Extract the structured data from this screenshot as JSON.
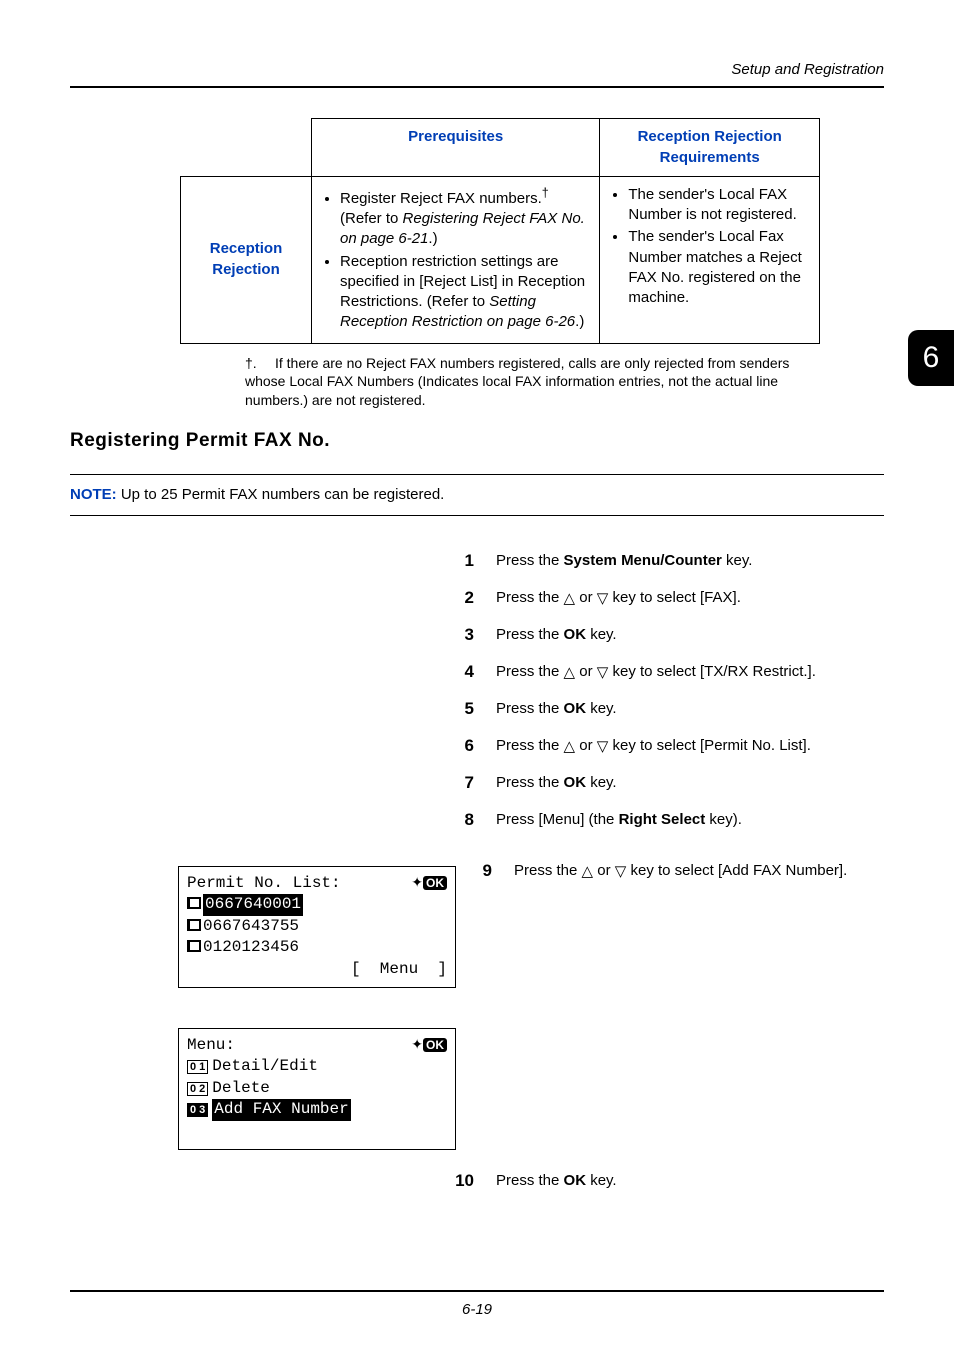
{
  "header": {
    "section": "Setup and Registration"
  },
  "chapterTab": "6",
  "table": {
    "headers": {
      "prereq": "Prerequisites",
      "req": "Reception Rejection Requirements"
    },
    "rowLabel": "Reception Rejection",
    "prereq": {
      "b1a": "Register Reject FAX numbers.",
      "b1b": "  (Refer to ",
      "b1c": "Registering Reject FAX No. on page 6-21",
      "b1d": ".)",
      "b2a": "Reception restriction settings are specified in [Reject List] in Reception Restrictions. (Refer to ",
      "b2b": "Setting Reception Restriction on page 6-26",
      "b2c": ".)"
    },
    "req": {
      "b1": "The sender's Local FAX Number is not registered.",
      "b2": "The sender's Local Fax Number matches a Reject FAX No. registered on the machine."
    }
  },
  "footnote": {
    "mark": "†.",
    "text": "If there are no Reject FAX numbers registered, calls are only rejected from senders whose Local FAX Numbers (Indicates local FAX information entries, not the actual line numbers.) are not registered."
  },
  "sectionTitle": "Registering Permit FAX No.",
  "note": {
    "label": "NOTE:",
    "text": " Up to 25 Permit FAX numbers can be registered."
  },
  "steps": {
    "s1a": "Press the ",
    "s1b": "System Menu/Counter",
    "s1c": " key.",
    "s2a": "Press the ",
    "s2b": " or ",
    "s2c": " key to select [FAX].",
    "s3a": "Press the ",
    "s3b": "OK",
    "s3c": " key.",
    "s4a": "Press the ",
    "s4b": " or ",
    "s4c": " key to select [TX/RX Restrict.].",
    "s5a": "Press the ",
    "s5b": "OK",
    "s5c": " key.",
    "s6a": "Press the ",
    "s6b": " or ",
    "s6c": " key to select [Permit No. List].",
    "s7a": "Press the ",
    "s7b": "OK",
    "s7c": " key.",
    "s8a": "Press [Menu] (the ",
    "s8b": "Right Select",
    "s8c": " key).",
    "s9a": "Press the ",
    "s9b": " or ",
    "s9c": " key to select [Add FAX Number].",
    "s10a": "Press the ",
    "s10b": "OK",
    "s10c": " key."
  },
  "lcd1": {
    "title": "Permit No. List:",
    "r1": "0667640001",
    "r2": "0667643755",
    "r3": "0120123456",
    "softkey": "[  Menu  ]"
  },
  "lcd2": {
    "title": "Menu:",
    "i1": {
      "n": "0 1",
      "t": "Detail/Edit"
    },
    "i2": {
      "n": "0 2",
      "t": "Delete"
    },
    "i3": {
      "n": "0 3",
      "t": "Add FAX Number"
    }
  },
  "pageNumber": "6-19"
}
